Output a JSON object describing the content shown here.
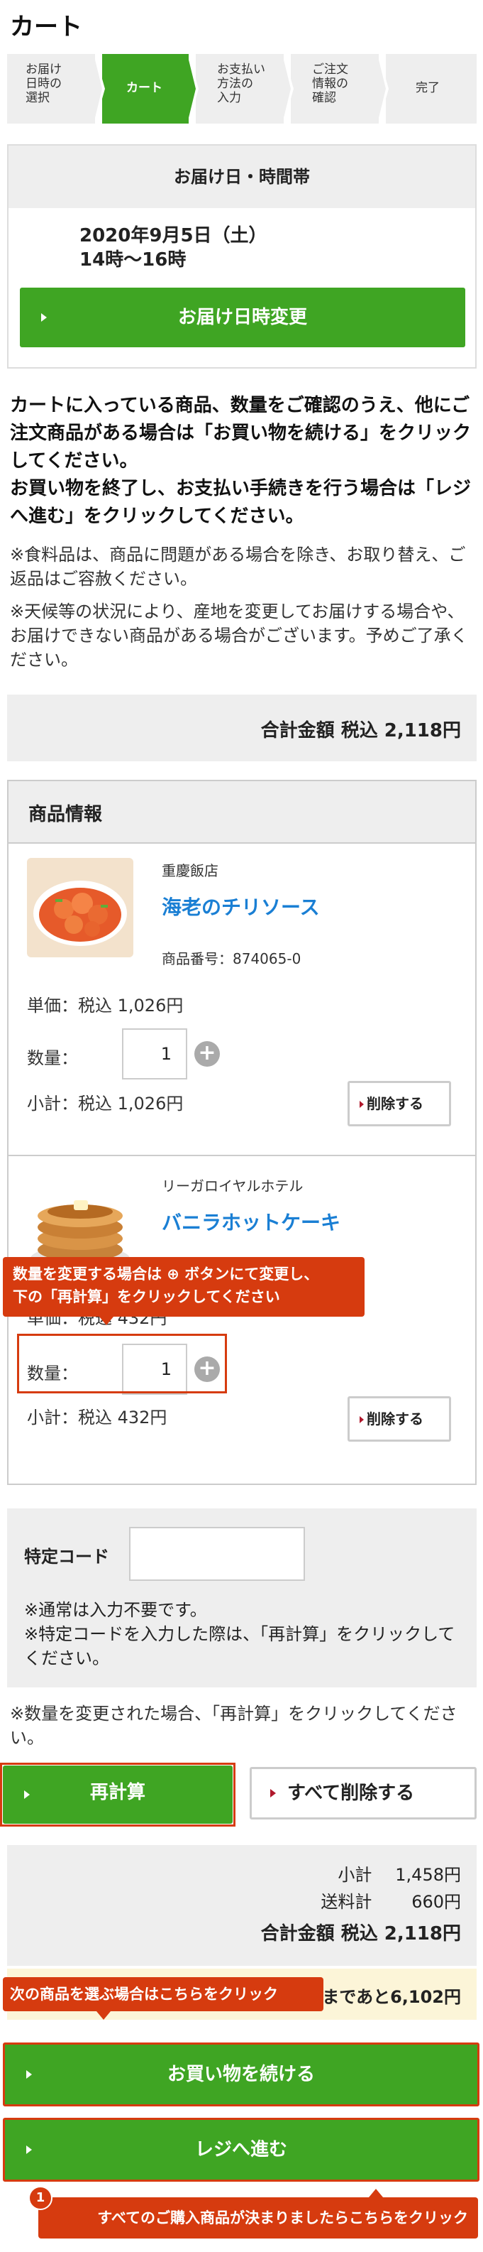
{
  "page": {
    "title": "カート"
  },
  "steps": [
    {
      "label": "お届け\n日時の\n選択"
    },
    {
      "label": "カート"
    },
    {
      "label": "お支払い\n方法の\n入力"
    },
    {
      "label": "ご注文\n情報の\n確認"
    },
    {
      "label": "完了"
    }
  ],
  "delivery": {
    "heading": "お届け日・時間帯",
    "date": "2020年9月5日（土）",
    "time": "14時～16時",
    "change_button": "お届け日時変更"
  },
  "intro_text": "カートに入っている商品、数量をご確認のうえ、他にご注文商品がある場合は「お買い物を続ける」をクリックしてください。\nお買い物を終了し、お支払い手続きを行う場合は「レジへ進む」をクリックしてください。",
  "notes": [
    "※食料品は、商品に問題がある場合を除き、お取り替え、ご返品はご容赦ください。",
    "※天候等の状況により、産地を変更してお届けする場合や、お届けできない商品がある場合がございます。予めご了承ください。"
  ],
  "total_top": "合計金額 税込 2,118円",
  "products_heading": "商品情報",
  "products": [
    {
      "shop": "重慶飯店",
      "name": "海老のチリソース",
      "code": "商品番号：874065-0",
      "unit_price": "単価：税込 1,026円",
      "qty_label": "数量：",
      "qty": "1",
      "subtotal": "小計：税込 1,026円",
      "delete": "削除する"
    },
    {
      "shop": "リーガロイヤルホテル",
      "name": "バニラホットケーキ",
      "code": "",
      "unit_price": "単価：税込 432円",
      "qty_label": "数量：",
      "qty": "1",
      "subtotal": "小計：税込 432円",
      "delete": "削除する"
    }
  ],
  "callouts": {
    "qty_help": "数量を変更する場合は ⊕ ボタンにて変更し、\n下の「再計算」をクリックしてください",
    "continue_help": "次の商品を選ぶ場合はこちらをクリック",
    "register_help": "すべてのご購入商品が決まりましたらこちらをクリック",
    "badge": "1"
  },
  "code": {
    "label": "特定コード",
    "value": "",
    "note": "※通常は入力不要です。\n※特定コードを入力した際は、「再計算」をクリックしてください。"
  },
  "recalc_note": "※数量を変更された場合、「再計算」をクリックしてください。",
  "buttons": {
    "recalc": "再計算",
    "delete_all": "すべて削除する",
    "continue": "お買い物を続ける",
    "register": "レジへ進む"
  },
  "summary": {
    "subtotal_label": "小計",
    "subtotal": "1,458円",
    "shipping_label": "送料計",
    "shipping": "660円",
    "total": "合計金額 税込 2,118円"
  },
  "free_shipping": "送料無料まであと6,102円",
  "colors": {
    "accent": "#3fa523",
    "callout": "#d63b0f",
    "link": "#1a7fd4",
    "delete_arrow": "#b0182c"
  }
}
